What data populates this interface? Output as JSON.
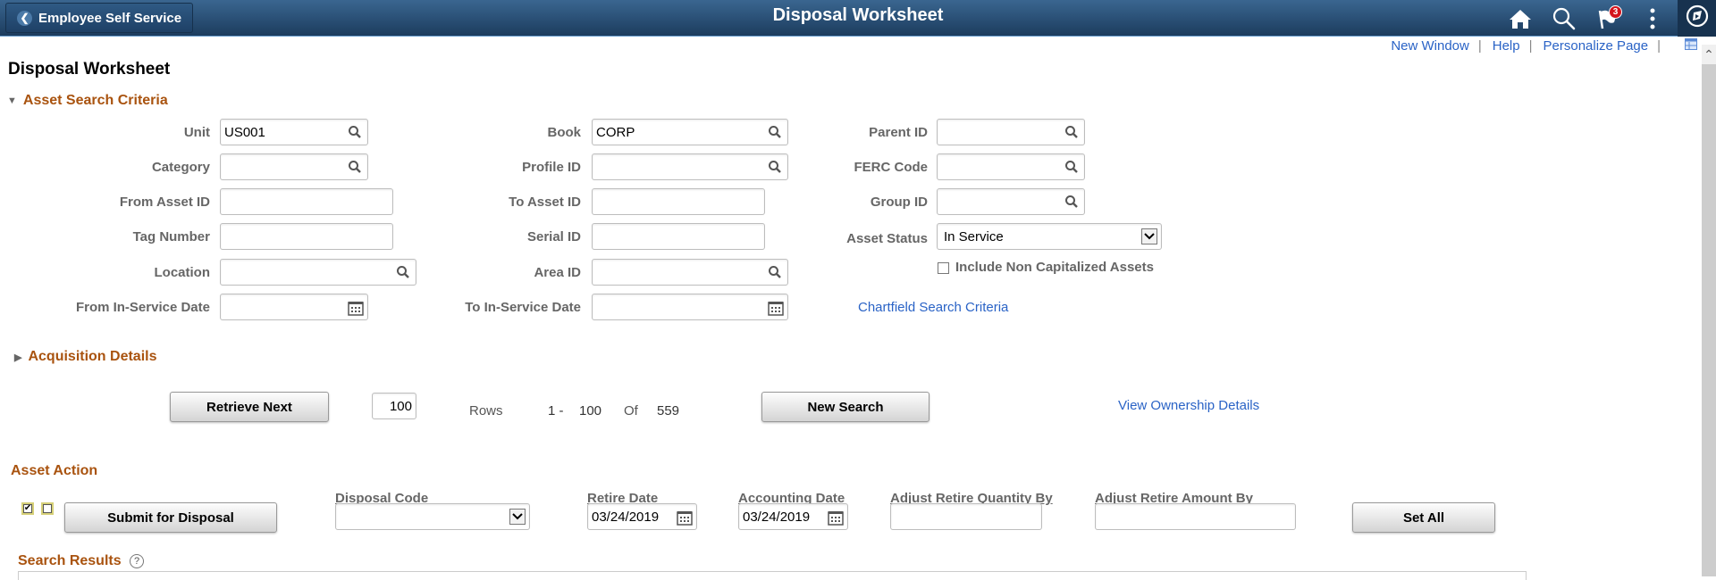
{
  "banner": {
    "back_label": "Employee Self Service",
    "title": "Disposal Worksheet",
    "notification_count": "3",
    "icons": [
      "home-icon",
      "search-icon",
      "notification-flag-icon",
      "actions-menu-icon",
      "navbar-compass-icon"
    ]
  },
  "toplinks": {
    "new_window": "New Window",
    "help": "Help",
    "personalize": "Personalize Page",
    "separator": "|"
  },
  "page": {
    "title": "Disposal Worksheet"
  },
  "search_criteria": {
    "header": "Asset Search Criteria",
    "col1": {
      "unit": {
        "label": "Unit",
        "value": "US001"
      },
      "category": {
        "label": "Category",
        "value": ""
      },
      "from_asset_id": {
        "label": "From Asset ID",
        "value": ""
      },
      "tag_number": {
        "label": "Tag Number",
        "value": ""
      },
      "location": {
        "label": "Location",
        "value": ""
      },
      "from_in_service_date": {
        "label": "From In-Service Date",
        "value": ""
      }
    },
    "col2": {
      "book": {
        "label": "Book",
        "value": "CORP"
      },
      "profile_id": {
        "label": "Profile ID",
        "value": ""
      },
      "to_asset_id": {
        "label": "To Asset ID",
        "value": ""
      },
      "serial_id": {
        "label": "Serial ID",
        "value": ""
      },
      "area_id": {
        "label": "Area ID",
        "value": ""
      },
      "to_in_service_date": {
        "label": "To In-Service Date",
        "value": ""
      }
    },
    "col3": {
      "parent_id": {
        "label": "Parent ID",
        "value": ""
      },
      "ferc_code": {
        "label": "FERC Code",
        "value": ""
      },
      "group_id": {
        "label": "Group ID",
        "value": ""
      },
      "asset_status": {
        "label": "Asset Status",
        "value": "In Service"
      },
      "include_non_cap": {
        "label": "Include Non Capitalized Assets",
        "checked": false
      },
      "chartfield_link": "Chartfield Search Criteria"
    }
  },
  "acquisition": {
    "header": "Acquisition Details"
  },
  "retrieval": {
    "retrieve_next": "Retrieve Next",
    "row_count": "100",
    "rows_label": "Rows",
    "range_start": "1 -",
    "range_end": "100",
    "of_label": "Of",
    "total": "559",
    "new_search": "New Search",
    "ownership_link": "View Ownership Details"
  },
  "asset_action": {
    "header": "Asset Action",
    "select_all_checked": true,
    "deselect_all_checked": false,
    "submit_label": "Submit for Disposal",
    "disposal_code": {
      "label": "Disposal Code",
      "value": ""
    },
    "retire_date": {
      "label": "Retire Date",
      "value": "03/24/2019"
    },
    "accounting_date": {
      "label": "Accounting Date",
      "value": "03/24/2019"
    },
    "adjust_qty": {
      "label": "Adjust Retire Quantity By",
      "value": ""
    },
    "adjust_amt": {
      "label": "Adjust Retire Amount By",
      "value": ""
    },
    "set_all": "Set All"
  },
  "search_results": {
    "header": "Search Results",
    "help_glyph": "?"
  }
}
